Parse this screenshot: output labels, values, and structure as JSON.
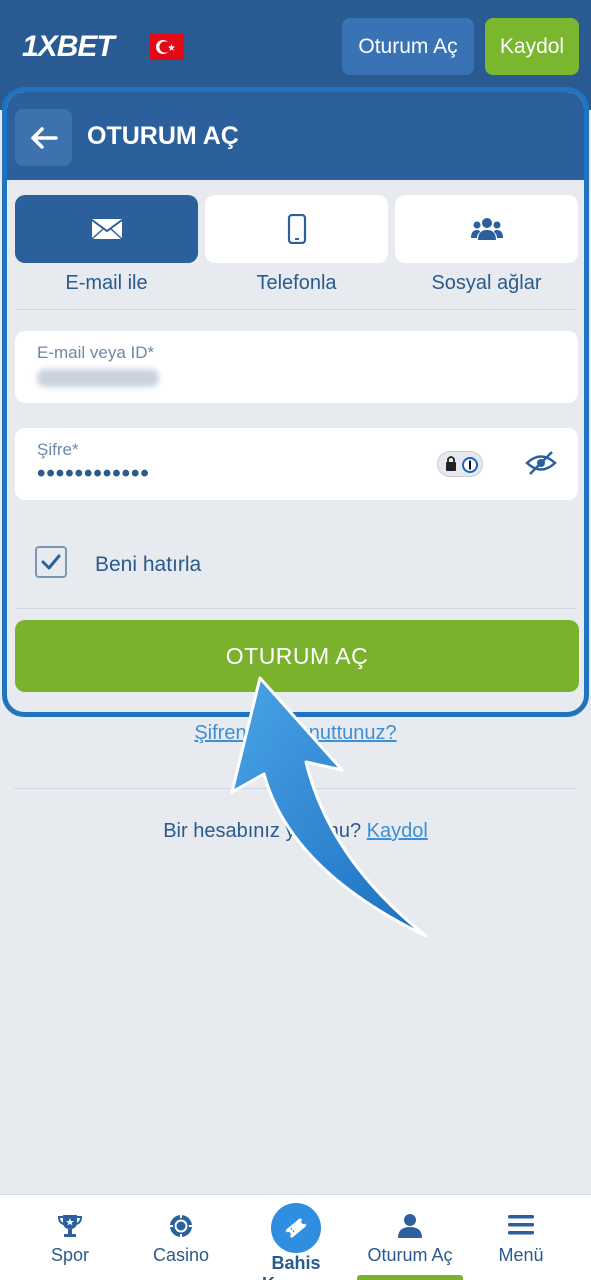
{
  "header": {
    "logo": "1XBET",
    "login_label": "Oturum Aç",
    "register_label": "Kaydol",
    "flag_icon": "turkey-flag-icon"
  },
  "panel": {
    "title": "OTURUM AÇ",
    "back_icon": "back-arrow-icon",
    "tabs": [
      {
        "label": "E-mail ile",
        "icon": "envelope-icon",
        "active": true
      },
      {
        "label": "Telefonla",
        "icon": "phone-icon",
        "active": false
      },
      {
        "label": "Sosyal ağlar",
        "icon": "people-icon",
        "active": false
      }
    ],
    "email_field": {
      "label": "E-mail veya ID*"
    },
    "password_field": {
      "label": "Şifre*",
      "value": "••••••••••••"
    },
    "remember_label": "Beni hatırla",
    "remember_checked": true,
    "submit_label": "OTURUM AÇ"
  },
  "forgot_password": "Şifrenizi mi unuttunuz?",
  "no_account": {
    "text": "Bir hesabınız yok mu?",
    "link": "Kaydol"
  },
  "bottom_nav": [
    {
      "label": "Spor",
      "icon": "trophy-icon"
    },
    {
      "label": "Casino",
      "icon": "casino-chip-icon"
    },
    {
      "label": "Bahis Kuponu",
      "icon": "ticket-icon"
    },
    {
      "label": "Oturum Aç",
      "icon": "user-icon",
      "active": true
    },
    {
      "label": "Menü",
      "icon": "hamburger-menu-icon"
    }
  ],
  "colors": {
    "header_blue": "#295a92",
    "panel_border": "#1e74c0",
    "accent_green": "#7ab22e",
    "link_blue": "#3d8fd6"
  }
}
